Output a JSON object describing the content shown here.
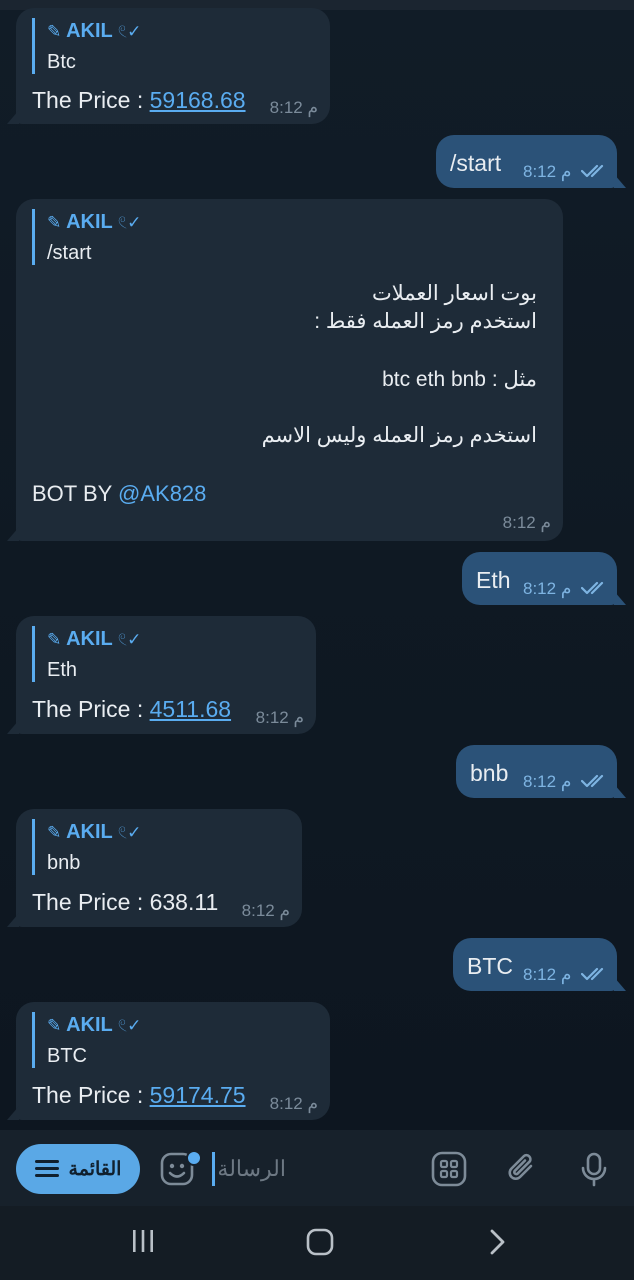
{
  "sender_name": "AKIL",
  "sender_deco_before": "✎",
  "sender_deco_after": "𓏲✓",
  "messages": {
    "m1": {
      "reply_text": "Btc",
      "price_label": "The Price : ",
      "price_value": "59168.68",
      "time": "8:12 م"
    },
    "m2": {
      "text": "/start",
      "time": "8:12 م"
    },
    "m3": {
      "reply_text": "/start",
      "lines": [
        "بوت اسعار العملات",
        "استخدم رمز العمله فقط  :",
        "مثل : btc eth bnb",
        "استخدم رمز العمله وليس الاسم"
      ],
      "footer_prefix": "BOT BY ",
      "footer_mention": "@AK828",
      "time": "8:12 م"
    },
    "m4": {
      "text": "Eth",
      "time": "8:12 م"
    },
    "m5": {
      "reply_text": "Eth",
      "price_label": "The Price : ",
      "price_value": "4511.68",
      "time": "8:12 م"
    },
    "m6": {
      "text": "bnb",
      "time": "8:12 م"
    },
    "m7": {
      "reply_text": "bnb",
      "price_text": "The Price : 638.11",
      "time": "8:12 م"
    },
    "m8": {
      "text": "BTC",
      "time": "8:12 م"
    },
    "m9": {
      "reply_text": "BTC",
      "price_label": "The Price : ",
      "price_value": "59174.75",
      "time": "8:12 م"
    }
  },
  "input_bar": {
    "menu_label": "القائمة",
    "placeholder": "الرسالة"
  },
  "colors": {
    "background": "#0e1621",
    "incoming_bubble": "#1e2b38",
    "outgoing_bubble": "#2b5278",
    "accent": "#5aacf0"
  },
  "icons": [
    "hamburger-icon",
    "emoji-icon",
    "apps-icon",
    "attach-icon",
    "mic-icon",
    "recents-icon",
    "home-icon",
    "back-icon",
    "double-check-icon"
  ]
}
